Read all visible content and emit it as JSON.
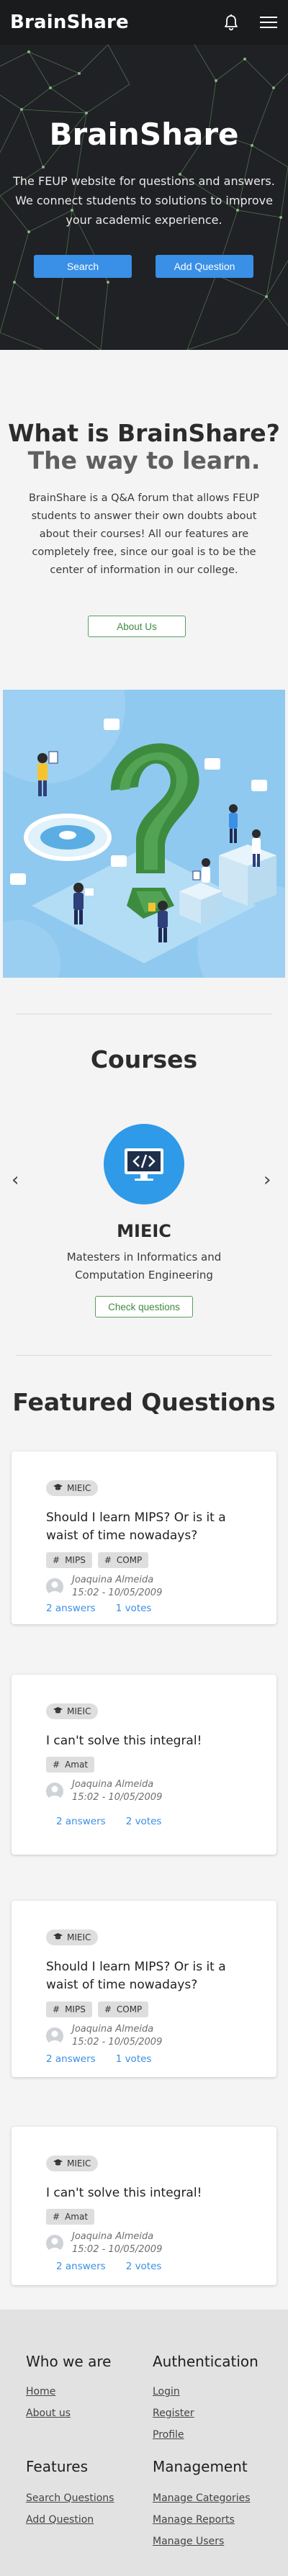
{
  "navbar": {
    "brand": "BrainShare",
    "icons": [
      "bell-icon",
      "hamburger-menu-icon"
    ]
  },
  "hero": {
    "title": "BrainShare",
    "text": "The FEUP website for questions and answers. We connect students to solutions to improve your academic experience.",
    "search_label": "Search",
    "add_question_label": "Add Question"
  },
  "about": {
    "title": "What is BrainShare?",
    "subtitle": "The way to learn.",
    "text": "BrainShare is a Q&A forum that allows FEUP students to answer their own doubts about about their courses! All our features are completely free, since our goal is to be the center of information in our college.",
    "button_label": "About Us"
  },
  "courses": {
    "title": "Courses",
    "items": [
      {
        "name": "MIEIC",
        "description": "Matesters in Informatics and Computation Engineering",
        "icon": "code-monitor-icon",
        "button_label": "Check questions"
      }
    ]
  },
  "featured": {
    "title": "Featured Questions",
    "questions": [
      {
        "course": "MIEIC",
        "title": "Should I learn MIPS? Or is it a waist of time nowadays?",
        "tags": [
          "MIPS",
          "COMP"
        ],
        "author": "Joaquina Almeida",
        "date": "15:02 - 10/05/2009",
        "answers": "2 answers",
        "votes": "1 votes"
      },
      {
        "course": "MIEIC",
        "title": "I can't solve this integral!",
        "tags": [
          "Amat"
        ],
        "author": "Joaquina Almeida",
        "date": "15:02 - 10/05/2009",
        "answers": "2 answers",
        "votes": "2 votes"
      },
      {
        "course": "MIEIC",
        "title": "Should I learn MIPS? Or is it a waist of time nowadays?",
        "tags": [
          "MIPS",
          "COMP"
        ],
        "author": "Joaquina Almeida",
        "date": "15:02 - 10/05/2009",
        "answers": "2 answers",
        "votes": "1 votes"
      },
      {
        "course": "MIEIC",
        "title": "I can't solve this integral!",
        "tags": [
          "Amat"
        ],
        "author": "Joaquina Almeida",
        "date": "15:02 - 10/05/2009",
        "answers": "2 answers",
        "votes": "2 votes"
      }
    ]
  },
  "footer": {
    "who": {
      "title": "Who we are",
      "links": [
        "Home",
        "About us"
      ]
    },
    "auth": {
      "title": "Authentication",
      "links": [
        "Login",
        "Register",
        "Profile"
      ]
    },
    "features": {
      "title": "Features",
      "links": [
        "Search Questions",
        "Add Question"
      ]
    },
    "management": {
      "title": "Management",
      "links": [
        "Manage Categories",
        "Manage Reports",
        "Manage Users"
      ]
    }
  },
  "colors": {
    "accent_blue": "#3a8fe6",
    "outline_green": "#5c9b5c",
    "hero_bg": "#202124",
    "navbar_bg": "#1a1b1d"
  }
}
